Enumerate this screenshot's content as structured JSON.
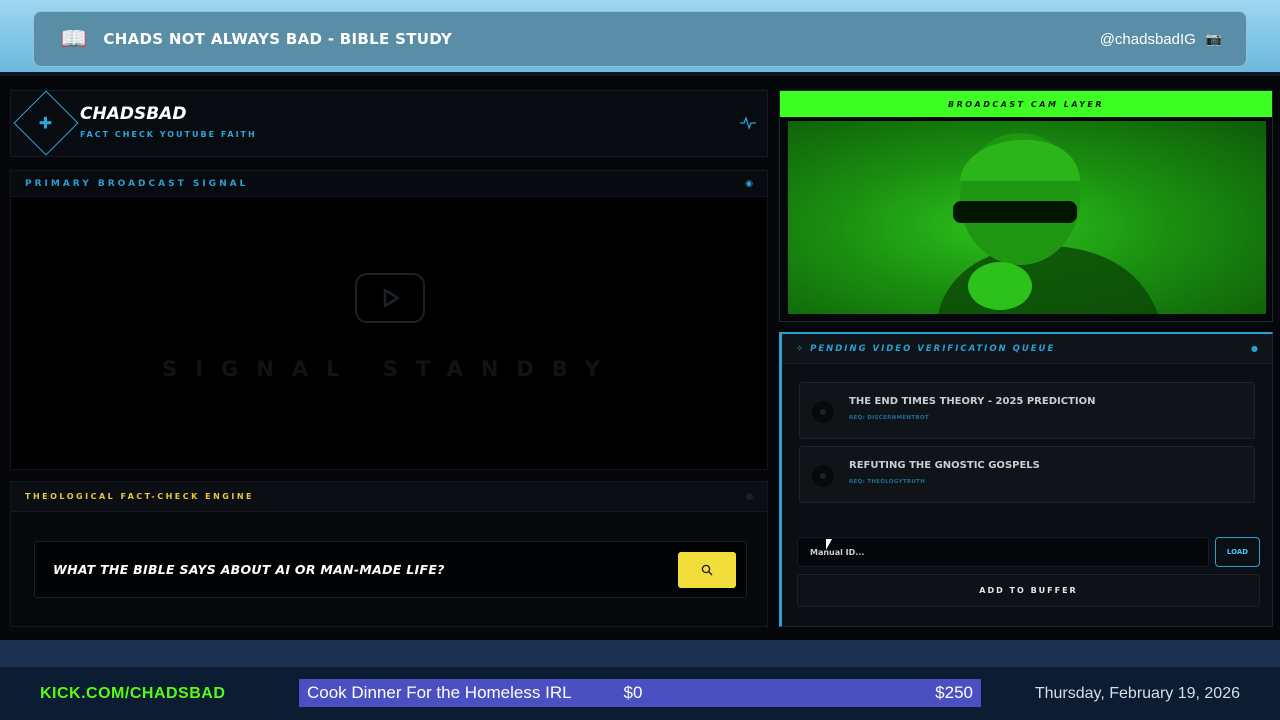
{
  "header": {
    "title": "CHADS NOT ALWAYS BAD - BIBLE STUDY",
    "handle": "@chadsbadIG",
    "book_icon": "book-icon",
    "camera_icon": "camera-icon"
  },
  "brand": {
    "name": "CHADSBAD",
    "subtitle": "FACT CHECK YOUTUBE FAITH",
    "logo_icon": "diamond-plus-icon",
    "pulse_icon": "pulse-icon"
  },
  "broadcast": {
    "label": "PRIMARY BROADCAST SIGNAL",
    "standby_text": "SIGNAL STANDBY",
    "play_icon": "play-icon"
  },
  "factcheck": {
    "label": "THEOLOGICAL FACT-CHECK ENGINE",
    "query": "WHAT THE BIBLE SAYS ABOUT AI OR MAN-MADE LIFE?",
    "search_icon": "search-icon"
  },
  "cam": {
    "label": "BROADCAST CAM LAYER"
  },
  "queue": {
    "label": "PENDING VIDEO VERIFICATION QUEUE",
    "items": [
      {
        "title": "THE END TIMES THEORY - 2025 PREDICTION",
        "req": "REQ: DISCERNMENTBOT"
      },
      {
        "title": "REFUTING THE GNOSTIC GOSPELS",
        "req": "REQ: THEOLOGYTRUTH"
      }
    ],
    "input_placeholder": "Manual ID...",
    "load_label": "LOAD",
    "add_label": "ADD TO BUFFER"
  },
  "footer": {
    "link": "KICK.COM/CHADSBAD",
    "goal_title": "Cook Dinner For the Homeless IRL",
    "goal_current": "$0",
    "goal_target": "$250",
    "goal_progress": 0,
    "date": "Thursday, February 19, 2026"
  },
  "colors": {
    "accent_blue": "#2a9fd0",
    "cam_green": "#3dff24",
    "search_yellow": "#f2de3a",
    "kick_green": "#53fc18",
    "goal_purple": "#4a4fc2"
  }
}
